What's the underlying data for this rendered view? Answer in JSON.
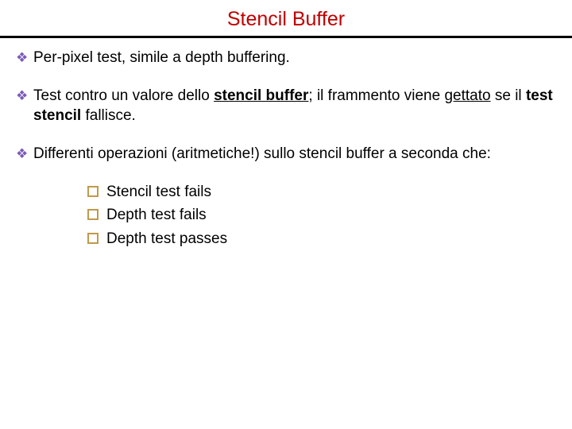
{
  "title": "Stencil Buffer",
  "bullets": {
    "b1": "Per-pixel test, simile a depth buffering.",
    "b2": {
      "pre": "Test contro un valore dello ",
      "stencil_buffer": "stencil buffer",
      "mid1": "; il frammento viene ",
      "gettato": "gettato",
      "mid2": " se il ",
      "test_stencil": "test stencil",
      "post": " fallisce."
    },
    "b3": "Differenti operazioni (aritmetiche!) sullo stencil buffer a seconda che:"
  },
  "sublist": {
    "s1": "Stencil test fails",
    "s2": "Depth test fails",
    "s3": "Depth test passes"
  }
}
